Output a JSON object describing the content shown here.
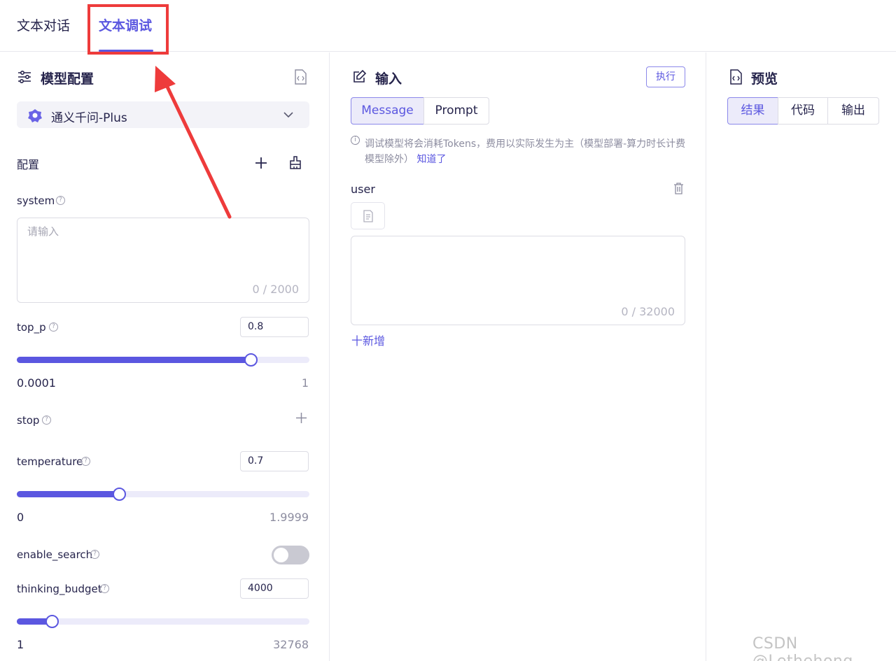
{
  "tabs": [
    {
      "label": "文本对话"
    },
    {
      "label": "文本调试"
    }
  ],
  "model_config": {
    "title": "模型配置",
    "selected_model": "通义千问-Plus",
    "config_label": "配置",
    "system": {
      "label": "system",
      "placeholder": "请输入",
      "count": "0 / 2000"
    },
    "top_p": {
      "label": "top_p",
      "value": "0.8",
      "min": "0.0001",
      "max": "1",
      "fraction": 0.8
    },
    "stop": {
      "label": "stop"
    },
    "temperature": {
      "label": "temperature",
      "value": "0.7",
      "min": "0",
      "max": "1.9999",
      "fraction": 0.35
    },
    "enable_search": {
      "label": "enable_search",
      "on": false
    },
    "thinking_budget": {
      "label": "thinking_budget",
      "value": "4000",
      "min": "1",
      "max": "32768",
      "fraction": 0.12
    }
  },
  "input_panel": {
    "title": "输入",
    "execute_label": "执行",
    "modes": [
      "Message",
      "Prompt"
    ],
    "active_mode": "Message",
    "notice": "调试模型将会消耗Tokens，费用以实际发生为主（模型部署-算力时长计费模型除外）",
    "notice_link": "知道了",
    "role": "user",
    "message_count": "0 / 32000",
    "add_label": "十新增"
  },
  "preview_panel": {
    "title": "预览",
    "tabs": [
      "结果",
      "代码",
      "输出"
    ],
    "active_tab": "结果"
  },
  "watermark": "CSDN @Lethehong",
  "colors": {
    "accent": "#5b57e0",
    "highlight": "#ee3b3b"
  }
}
